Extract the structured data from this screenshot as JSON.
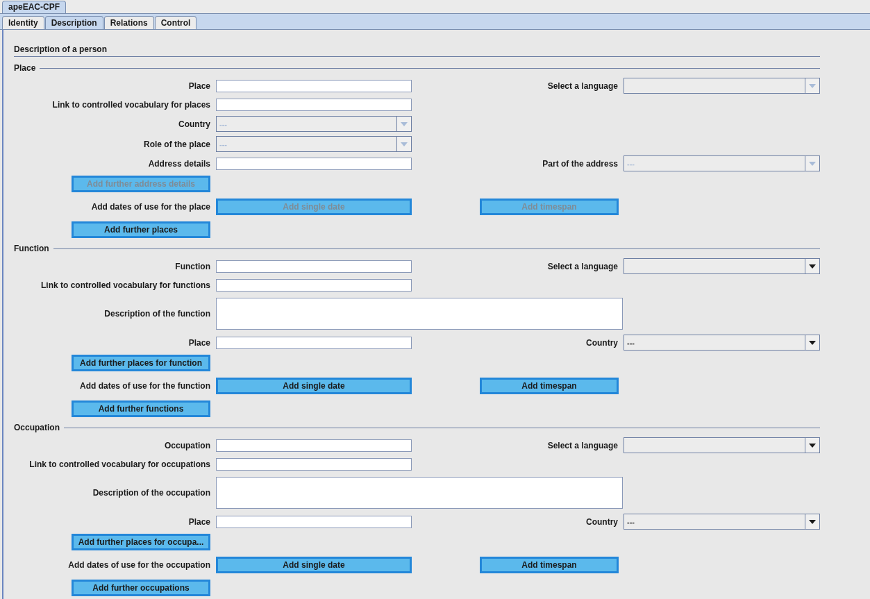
{
  "app_tab": {
    "label": "apeEAC-CPF",
    "selected": true
  },
  "tabs": [
    {
      "label": "Identity",
      "selected": false
    },
    {
      "label": "Description",
      "selected": true
    },
    {
      "label": "Relations",
      "selected": false
    },
    {
      "label": "Control",
      "selected": false
    }
  ],
  "heading": "Description of a person",
  "sections": [
    {
      "title": "Place",
      "rows": [
        {
          "kind": "text",
          "label": "Place",
          "right": {
            "label": "Select a language",
            "disabled": true
          }
        },
        {
          "kind": "text",
          "label": "Link to controlled vocabulary for places"
        },
        {
          "kind": "select",
          "label": "Country",
          "value": "---",
          "disabled": true
        },
        {
          "kind": "select",
          "label": "Role of the place",
          "value": "---",
          "disabled": true
        },
        {
          "kind": "text",
          "label": "Address details",
          "right": {
            "label": "Part of the address",
            "value": "---",
            "disabled": true
          }
        },
        {
          "kind": "button",
          "button": {
            "label": "Add further address details",
            "disabled": true
          }
        },
        {
          "kind": "dates",
          "label": "Add dates of use for the place",
          "buttons": [
            {
              "label": "Add single date",
              "disabled": true
            },
            {
              "label": "Add timespan",
              "disabled": true
            }
          ]
        },
        {
          "kind": "button",
          "button": {
            "label": "Add further places",
            "disabled": false
          }
        }
      ]
    },
    {
      "title": "Function",
      "rows": [
        {
          "kind": "text",
          "label": "Function",
          "right": {
            "label": "Select a language",
            "disabled": false
          }
        },
        {
          "kind": "text",
          "label": "Link to controlled vocabulary for functions"
        },
        {
          "kind": "textarea",
          "label": "Description of the function"
        },
        {
          "kind": "text",
          "label": "Place",
          "right": {
            "label": "Country",
            "value": "---",
            "disabled": false
          }
        },
        {
          "kind": "button",
          "button": {
            "label": "Add further places for function",
            "disabled": false
          }
        },
        {
          "kind": "dates",
          "label": "Add dates of use for the function",
          "buttons": [
            {
              "label": "Add single date",
              "disabled": false
            },
            {
              "label": "Add timespan",
              "disabled": false
            }
          ]
        },
        {
          "kind": "button",
          "button": {
            "label": "Add further functions",
            "disabled": false
          }
        }
      ]
    },
    {
      "title": "Occupation",
      "rows": [
        {
          "kind": "text",
          "label": "Occupation",
          "right": {
            "label": "Select a language",
            "disabled": false
          }
        },
        {
          "kind": "text",
          "label": "Link to controlled vocabulary for occupations"
        },
        {
          "kind": "textarea",
          "label": "Description of the occupation"
        },
        {
          "kind": "text",
          "label": "Place",
          "right": {
            "label": "Country",
            "value": "---",
            "disabled": false
          }
        },
        {
          "kind": "button",
          "button": {
            "label": "Add further places for occupa...",
            "disabled": false
          }
        },
        {
          "kind": "dates",
          "label": "Add dates of use for the occupation",
          "buttons": [
            {
              "label": "Add single date",
              "disabled": false
            },
            {
              "label": "Add timespan",
              "disabled": false
            }
          ]
        },
        {
          "kind": "button",
          "button": {
            "label": "Add further occupations",
            "disabled": false
          }
        }
      ]
    }
  ]
}
